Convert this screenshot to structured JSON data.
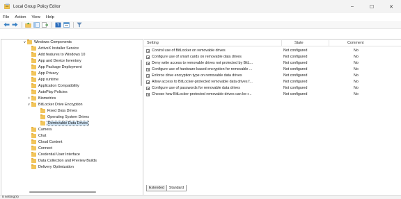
{
  "window": {
    "title": "Local Group Policy Editor",
    "controls": {
      "minimize": "–",
      "maximize": "☐",
      "close": "✕"
    }
  },
  "menu": [
    "File",
    "Action",
    "View",
    "Help"
  ],
  "toolbar": {
    "icons": [
      "back-arrow-icon",
      "forward-arrow-icon",
      "folder-up-icon",
      "show-hide-tree-icon",
      "export-list-icon",
      "help-icon",
      "properties-icon",
      "filter-icon"
    ]
  },
  "tree": {
    "items": [
      {
        "label": "Windows Components",
        "chevron": "∨"
      },
      {
        "label": "ActiveX Installer Service",
        "chevron": ""
      },
      {
        "label": "Add features to Windows 10",
        "chevron": ""
      },
      {
        "label": "App and Device Inventory",
        "chevron": ""
      },
      {
        "label": "App Package Deployment",
        "chevron": ""
      },
      {
        "label": "App Privacy",
        "chevron": ""
      },
      {
        "label": "App runtime",
        "chevron": ""
      },
      {
        "label": "Application Compatibility",
        "chevron": ""
      },
      {
        "label": "AutoPlay Policies",
        "chevron": ""
      },
      {
        "label": "Biometrics",
        "chevron": ">"
      },
      {
        "label": "BitLocker Drive Encryption",
        "chevron": "∨"
      },
      {
        "label": "Fixed Data Drives",
        "chevron": ""
      },
      {
        "label": "Operating System Drives",
        "chevron": ""
      },
      {
        "label": "Removable Data Drives",
        "chevron": ""
      },
      {
        "label": "Camera",
        "chevron": ""
      },
      {
        "label": "Chat",
        "chevron": ""
      },
      {
        "label": "Cloud Content",
        "chevron": ""
      },
      {
        "label": "Connect",
        "chevron": ""
      },
      {
        "label": "Credential User Interface",
        "chevron": ""
      },
      {
        "label": "Data Collection and Preview Builds",
        "chevron": ""
      },
      {
        "label": "Delivery Optimization",
        "chevron": ""
      }
    ]
  },
  "list": {
    "columns": {
      "setting": "Setting",
      "state": "State",
      "comment": "Comment"
    },
    "rows": [
      {
        "setting": "Control use of BitLocker on removable drives",
        "state": "Not configured",
        "comment": "No"
      },
      {
        "setting": "Configure use of smart cards on removable data drives",
        "state": "Not configured",
        "comment": "No"
      },
      {
        "setting": "Deny write access to removable drives not protected by BitL...",
        "state": "Not configured",
        "comment": "No"
      },
      {
        "setting": "Configure use of hardware-based encryption for removable ...",
        "state": "Not configured",
        "comment": "No"
      },
      {
        "setting": "Enforce drive encryption type on removable data drives",
        "state": "Not configured",
        "comment": "No"
      },
      {
        "setting": "Allow access to BitLocker-protected removable data drives f...",
        "state": "Not configured",
        "comment": "No"
      },
      {
        "setting": "Configure use of passwords for removable data drives",
        "state": "Not configured",
        "comment": "No"
      },
      {
        "setting": "Choose how BitLocker-protected removable drives can be r...",
        "state": "Not configured",
        "comment": "No"
      }
    ]
  },
  "tabs": {
    "extended": "Extended",
    "standard": "Standard"
  },
  "status": {
    "text": "8 setting(s)"
  },
  "colors": {
    "folder": "#f2c55b",
    "selected": "#cde3f5"
  }
}
